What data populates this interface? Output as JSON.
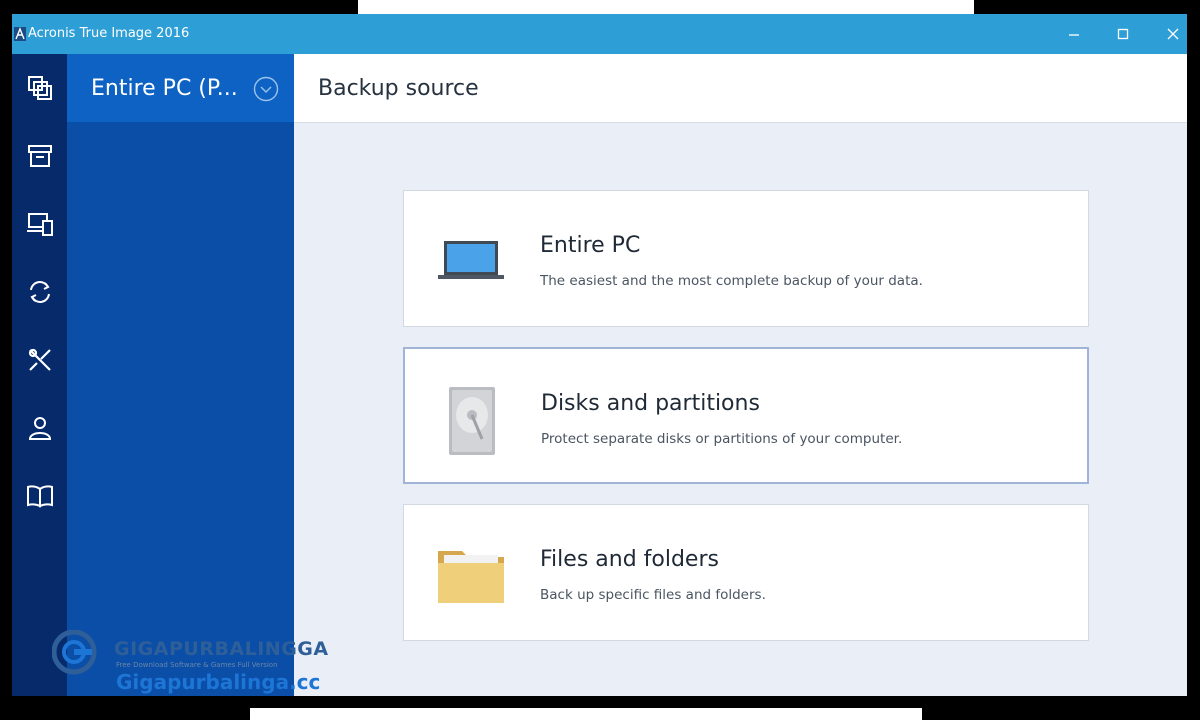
{
  "window": {
    "title": "Acronis True Image 2016",
    "controls": [
      "minimize",
      "maximize",
      "close"
    ]
  },
  "rail": {
    "items": [
      {
        "icon": "backup-icon"
      },
      {
        "icon": "archive-icon"
      },
      {
        "icon": "devices-icon"
      },
      {
        "icon": "sync-icon"
      },
      {
        "icon": "tools-icon"
      },
      {
        "icon": "account-icon"
      },
      {
        "icon": "help-book-icon"
      }
    ]
  },
  "panel": {
    "header_title": "Entire PC (P...",
    "chevron_icon": "chevron-down-circle-icon"
  },
  "main": {
    "title": "Backup source",
    "options": [
      {
        "title": "Entire PC",
        "description": "The easiest and the most complete backup of your data.",
        "icon": "laptop-icon",
        "selected": false
      },
      {
        "title": "Disks and partitions",
        "description": "Protect separate disks or partitions of your computer.",
        "icon": "hard-disk-icon",
        "selected": true
      },
      {
        "title": "Files and folders",
        "description": "Back up specific files and folders.",
        "icon": "folder-icon",
        "selected": false
      }
    ]
  },
  "watermark": {
    "brand": "GIGAPURBALINGGA",
    "tagline": "Free Download Software & Games Full Version",
    "url": "Gigapurbalinga.cc"
  },
  "colors": {
    "titlebar": "#2e9fd6",
    "rail": "#072a6b",
    "panel": "#0a4ea7",
    "panel_header": "#0e62c4",
    "content_bg": "#eaeef6",
    "selected_border": "#9fb4d6"
  }
}
